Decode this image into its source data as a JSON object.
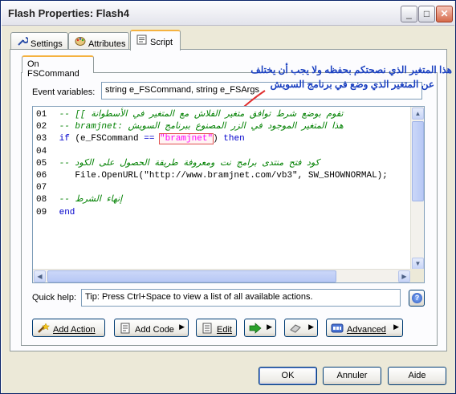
{
  "window": {
    "title": "Flash Properties: Flash4",
    "min_glyph": "_",
    "max_glyph": "□",
    "close_glyph": "✕"
  },
  "tabs": [
    {
      "label": "Settings",
      "icon": "wrench-icon"
    },
    {
      "label": "Attributes",
      "icon": "palette-icon"
    },
    {
      "label": "Script",
      "icon": "script-icon"
    }
  ],
  "inner_tab": {
    "label": "On FSCommand"
  },
  "event_variables": {
    "label": "Event variables:",
    "value": "string e_FSCommand, string e_FSArgs"
  },
  "annotation": {
    "line1": "هذا المتغير الذي نصحتكم بحفظه ولا يجب أن يختلف",
    "line2": "عن المتغير الذي وضع في برنامج السويش",
    "color": "#1a40c0",
    "arrow_color": "#e03030"
  },
  "code": {
    "lines": [
      {
        "n": "01",
        "text": "-- [[ تقوم بوضع شرط توافق متغير الفلاش مع المتغير في الأسطوانة",
        "type": "comment"
      },
      {
        "n": "02",
        "text": "-- bramjnet: هذا المتغير الموجود في الزر المصنوع ببرنامج السويش",
        "type": "comment"
      },
      {
        "n": "03",
        "kw1": "if",
        "pre": " (e_FSCommand ",
        "op": "==",
        "mid": " ",
        "str": "\"bramjnet\"",
        "post": ") ",
        "kw2": "then",
        "type": "if"
      },
      {
        "n": "04",
        "text": "",
        "type": "blank"
      },
      {
        "n": "05",
        "text": "-- كود فتح منتدى برامج نت ومعروفة طريقة الحصول على الكود",
        "type": "comment"
      },
      {
        "n": "06",
        "text": "    File.OpenURL(\"http://www.bramjnet.com/vb3\", SW_SHOWNORMAL);",
        "type": "code"
      },
      {
        "n": "07",
        "text": "",
        "type": "blank"
      },
      {
        "n": "08",
        "text": "-- إنهاء الشرط",
        "type": "comment"
      },
      {
        "n": "09",
        "text": "end",
        "type": "keyword"
      }
    ]
  },
  "quick_help": {
    "label": "Quick help:",
    "value": "Tip: Press Ctrl+Space to view a list of all available actions."
  },
  "toolbar": {
    "add_action": "Add Action",
    "add_code": "Add Code",
    "edit": "Edit",
    "advanced": "Advanced"
  },
  "dialog_buttons": {
    "ok": "OK",
    "cancel": "Annuler",
    "help": "Aide"
  }
}
